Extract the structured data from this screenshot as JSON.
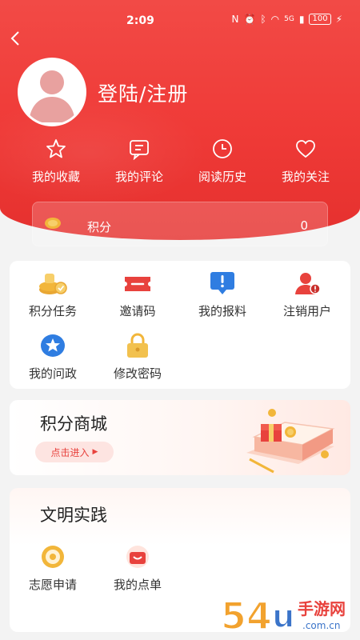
{
  "status_bar": {
    "time": "2:09",
    "network": "5G",
    "battery": "100"
  },
  "profile": {
    "login_label": "登陆/注册"
  },
  "quick_actions": [
    {
      "label": "我的收藏",
      "icon": "star-icon"
    },
    {
      "label": "我的评论",
      "icon": "comment-icon"
    },
    {
      "label": "阅读历史",
      "icon": "clock-icon"
    },
    {
      "label": "我的关注",
      "icon": "heart-icon"
    }
  ],
  "points": {
    "label": "积分",
    "value": "0"
  },
  "grid_items": [
    {
      "label": "积分任务",
      "icon": "coins-icon"
    },
    {
      "label": "邀请码",
      "icon": "ticket-icon"
    },
    {
      "label": "我的报料",
      "icon": "report-icon"
    },
    {
      "label": "注销用户",
      "icon": "user-remove-icon"
    },
    {
      "label": "我的问政",
      "icon": "star-badge-icon"
    },
    {
      "label": "修改密码",
      "icon": "lock-icon"
    }
  ],
  "mall": {
    "title": "积分商城",
    "enter_label": "点击进入"
  },
  "practice": {
    "title": "文明实践",
    "items": [
      {
        "label": "志愿申请",
        "icon": "volunteer-icon"
      },
      {
        "label": "我的点单",
        "icon": "order-icon"
      }
    ]
  },
  "watermark": {
    "text_main": "手游网",
    "text_num": "54",
    "text_sub": ".com.cn"
  },
  "colors": {
    "brand_red": "#ef3a37",
    "coin_gold": "#f2b63a",
    "blue": "#2f7de1"
  }
}
